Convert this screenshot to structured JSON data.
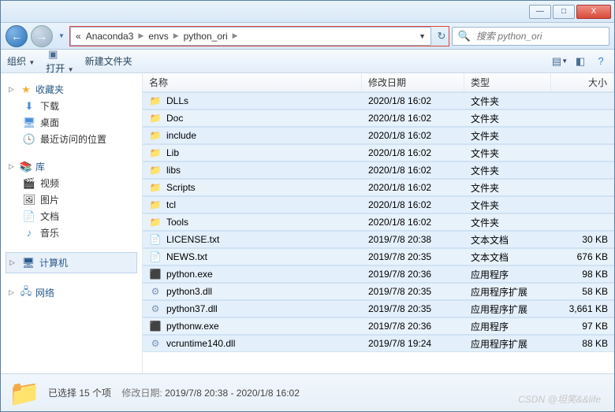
{
  "titlebar": {
    "min": "—",
    "max": "□",
    "close": "X"
  },
  "nav": {
    "chevrons": "«",
    "crumbs": [
      "Anaconda3",
      "envs",
      "python_ori"
    ],
    "refresh": "↻",
    "search_placeholder": "搜索 python_ori"
  },
  "toolbar": {
    "organize": "组织",
    "open": "打开",
    "newfolder": "新建文件夹"
  },
  "sidebar": {
    "favorites": "收藏夹",
    "downloads": "下载",
    "desktop": "桌面",
    "recent": "最近访问的位置",
    "library": "库",
    "videos": "视频",
    "pictures": "图片",
    "documents": "文档",
    "music": "音乐",
    "computer": "计算机",
    "network": "网络"
  },
  "columns": {
    "name": "名称",
    "date": "修改日期",
    "type": "类型",
    "size": "大小"
  },
  "files": [
    {
      "name": "DLLs",
      "date": "2020/1/8 16:02",
      "type": "文件夹",
      "size": "",
      "icon": "folder"
    },
    {
      "name": "Doc",
      "date": "2020/1/8 16:02",
      "type": "文件夹",
      "size": "",
      "icon": "folder"
    },
    {
      "name": "include",
      "date": "2020/1/8 16:02",
      "type": "文件夹",
      "size": "",
      "icon": "folder"
    },
    {
      "name": "Lib",
      "date": "2020/1/8 16:02",
      "type": "文件夹",
      "size": "",
      "icon": "folder"
    },
    {
      "name": "libs",
      "date": "2020/1/8 16:02",
      "type": "文件夹",
      "size": "",
      "icon": "folder"
    },
    {
      "name": "Scripts",
      "date": "2020/1/8 16:02",
      "type": "文件夹",
      "size": "",
      "icon": "folder"
    },
    {
      "name": "tcl",
      "date": "2020/1/8 16:02",
      "type": "文件夹",
      "size": "",
      "icon": "folder"
    },
    {
      "name": "Tools",
      "date": "2020/1/8 16:02",
      "type": "文件夹",
      "size": "",
      "icon": "folder"
    },
    {
      "name": "LICENSE.txt",
      "date": "2019/7/8 20:38",
      "type": "文本文档",
      "size": "30 KB",
      "icon": "txt"
    },
    {
      "name": "NEWS.txt",
      "date": "2019/7/8 20:35",
      "type": "文本文档",
      "size": "676 KB",
      "icon": "txt"
    },
    {
      "name": "python.exe",
      "date": "2019/7/8 20:36",
      "type": "应用程序",
      "size": "98 KB",
      "icon": "exe"
    },
    {
      "name": "python3.dll",
      "date": "2019/7/8 20:35",
      "type": "应用程序扩展",
      "size": "58 KB",
      "icon": "dll"
    },
    {
      "name": "python37.dll",
      "date": "2019/7/8 20:35",
      "type": "应用程序扩展",
      "size": "3,661 KB",
      "icon": "dll"
    },
    {
      "name": "pythonw.exe",
      "date": "2019/7/8 20:36",
      "type": "应用程序",
      "size": "97 KB",
      "icon": "exe"
    },
    {
      "name": "vcruntime140.dll",
      "date": "2019/7/8 19:24",
      "type": "应用程序扩展",
      "size": "88 KB",
      "icon": "dll"
    }
  ],
  "status": {
    "selected": "已选择 15 个项",
    "moddate_label": "修改日期:",
    "moddate_value": "2019/7/8 20:38 - 2020/1/8 16:02"
  },
  "watermark": "CSDN @坦笑&&life"
}
